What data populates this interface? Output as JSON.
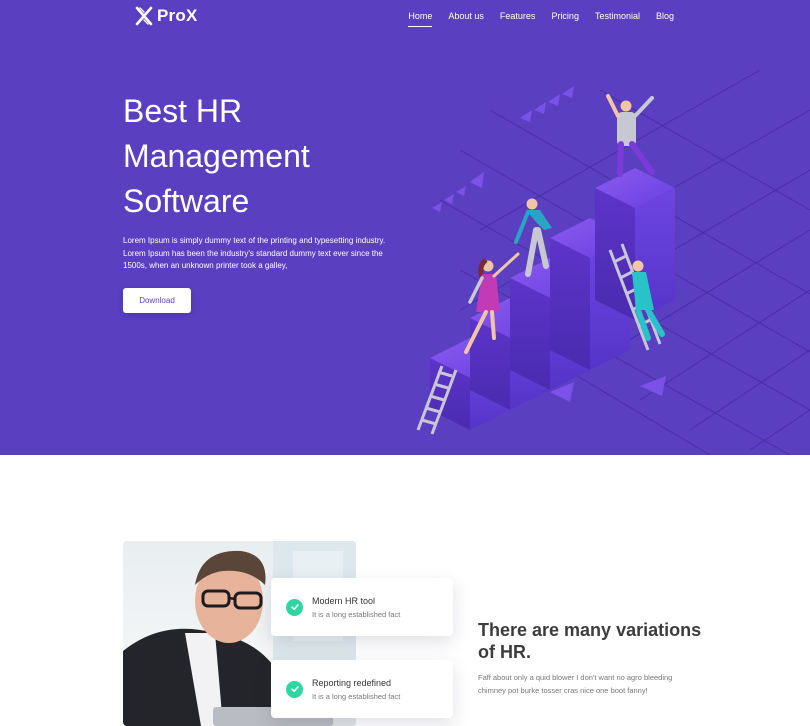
{
  "brand": {
    "name": "ProX",
    "logo_icon": "prox-logo-icon"
  },
  "nav": {
    "items": [
      {
        "label": "Home",
        "active": true
      },
      {
        "label": "About us",
        "active": false
      },
      {
        "label": "Features",
        "active": false
      },
      {
        "label": "Pricing",
        "active": false
      },
      {
        "label": "Testimonial",
        "active": false
      },
      {
        "label": "Blog",
        "active": false
      }
    ]
  },
  "hero": {
    "title": "Best HR Management Software",
    "description": "Lorem Ipsum is simply dummy text of the printing and typesetting industry. Lorem Ipsum has been the industry's standard dummy text ever since the 1500s, when an unknown printer took a galley,",
    "button_label": "Download",
    "background_color": "#5a3fc0",
    "illustration": "people-climbing-stairs-illustration"
  },
  "features": {
    "cards": [
      {
        "title": "Modern HR tool",
        "subtitle": "It is a long established fact",
        "icon": "check-circle-icon"
      },
      {
        "title": "Reporting redefined",
        "subtitle": "It is a long established fact",
        "icon": "check-circle-icon"
      }
    ],
    "heading": "There are many variations of HR.",
    "text": "Faff about only a quid blower I don't want no agro bleeding chimney pot burke tosser cras nice one boot fanny!",
    "photo": "businessman-photo",
    "accent_color": "#2fd6a1"
  }
}
